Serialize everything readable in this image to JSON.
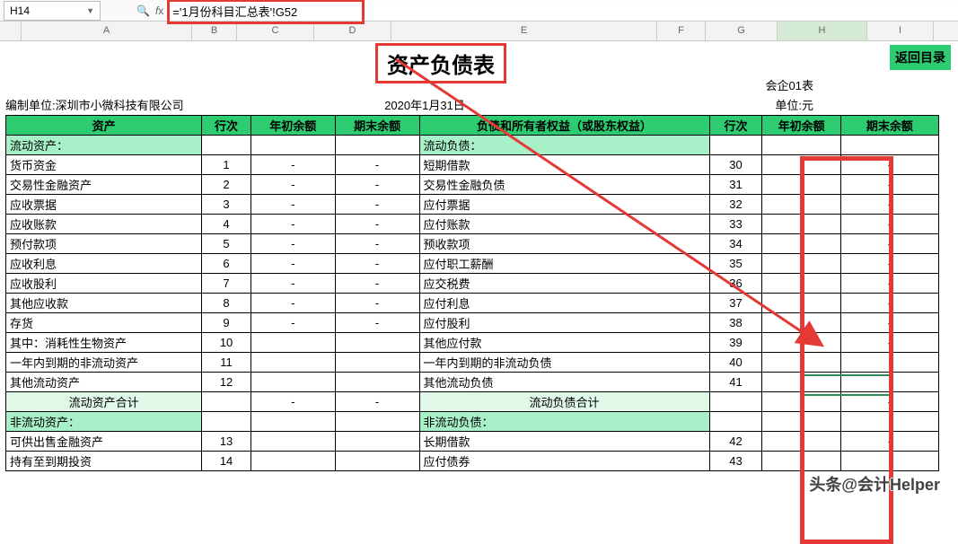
{
  "nameBox": "H14",
  "formula": "='1月份科目汇总表'!G52",
  "columns": [
    "A",
    "B",
    "C",
    "D",
    "E",
    "F",
    "G",
    "H",
    "I"
  ],
  "title": "资产负债表",
  "returnBtn": "返回目录",
  "formCode": "会企01表",
  "unitLabel": "单位:元",
  "org": "编制单位:深圳市小微科技有限公司",
  "date": "2020年1月31日",
  "headers": {
    "a": "资产",
    "b": "行次",
    "c": "年初余额",
    "d": "期末余额",
    "e": "负债和所有者权益（或股东权益）",
    "f": "行次",
    "g": "年初余额",
    "h": "期末余额"
  },
  "rows": [
    {
      "type": "sec",
      "a": "流动资产：",
      "e": "流动负债："
    },
    {
      "a": "货币资金",
      "b": "1",
      "c": "-",
      "d": "-",
      "e": "短期借款",
      "f": "30",
      "g": "",
      "h": "-"
    },
    {
      "a": "交易性金融资产",
      "b": "2",
      "c": "-",
      "d": "-",
      "e": "交易性金融负债",
      "f": "31",
      "g": "",
      "h": "-"
    },
    {
      "a": "应收票据",
      "b": "3",
      "c": "-",
      "d": "-",
      "e": "应付票据",
      "f": "32",
      "g": "-",
      "h": "-"
    },
    {
      "a": "应收账款",
      "b": "4",
      "c": "-",
      "d": "-",
      "e": "应付账款",
      "f": "33",
      "g": "-",
      "h": "-"
    },
    {
      "a": "预付款项",
      "b": "5",
      "c": "-",
      "d": "-",
      "e": "预收款项",
      "f": "34",
      "g": "-",
      "h": "-"
    },
    {
      "a": "应收利息",
      "b": "6",
      "c": "-",
      "d": "-",
      "e": "应付职工薪酬",
      "f": "35",
      "g": "",
      "h": "-"
    },
    {
      "a": "应收股利",
      "b": "7",
      "c": "-",
      "d": "-",
      "e": "应交税费",
      "f": "36",
      "g": "",
      "h": "-"
    },
    {
      "a": "其他应收款",
      "b": "8",
      "c": "-",
      "d": "-",
      "e": "应付利息",
      "f": "37",
      "g": "",
      "h": "-"
    },
    {
      "a": "存货",
      "b": "9",
      "c": "-",
      "d": "-",
      "e": "应付股利",
      "f": "38",
      "g": "",
      "h": "-"
    },
    {
      "a": "其中：消耗性生物资产",
      "b": "10",
      "c": "",
      "d": "",
      "e": "其他应付款",
      "f": "39",
      "g": "-",
      "h": "-"
    },
    {
      "a": "一年内到期的非流动资产",
      "b": "11",
      "c": "",
      "d": "",
      "e": "一年内到期的非流动负债",
      "f": "40",
      "g": "",
      "h": ""
    },
    {
      "a": "其他流动资产",
      "b": "12",
      "c": "",
      "d": "",
      "e": "其他流动负债",
      "f": "41",
      "g": "",
      "h": ""
    },
    {
      "type": "sub",
      "a": "流动资产合计",
      "c": "-",
      "d": "-",
      "e": "流动负债合计",
      "g": "-",
      "h": "-"
    },
    {
      "type": "sec",
      "a": "非流动资产：",
      "e": "非流动负债："
    },
    {
      "a": "可供出售金融资产",
      "b": "13",
      "c": "",
      "d": "",
      "e": "长期借款",
      "f": "42",
      "g": "-",
      "h": "-"
    },
    {
      "a": "持有至到期投资",
      "b": "14",
      "c": "",
      "d": "",
      "e": "应付债券",
      "f": "43",
      "g": "",
      "h": ""
    }
  ],
  "watermark": "头条@会计Helper",
  "chart_data": {
    "type": "table",
    "title": "资产负债表 (Balance Sheet)",
    "date": "2020年1月31日",
    "org": "深圳市小微科技有限公司",
    "unit": "元",
    "columns_left": [
      "资产",
      "行次",
      "年初余额",
      "期末余额"
    ],
    "columns_right": [
      "负债和所有者权益（或股东权益）",
      "行次",
      "年初余额",
      "期末余额"
    ],
    "records": [
      {
        "asset": "流动资产：",
        "liab": "流动负债："
      },
      {
        "asset": "货币资金",
        "a_row": 1,
        "liab": "短期借款",
        "l_row": 30
      },
      {
        "asset": "交易性金融资产",
        "a_row": 2,
        "liab": "交易性金融负债",
        "l_row": 31
      },
      {
        "asset": "应收票据",
        "a_row": 3,
        "liab": "应付票据",
        "l_row": 32
      },
      {
        "asset": "应收账款",
        "a_row": 4,
        "liab": "应付账款",
        "l_row": 33
      },
      {
        "asset": "预付款项",
        "a_row": 5,
        "liab": "预收款项",
        "l_row": 34
      },
      {
        "asset": "应收利息",
        "a_row": 6,
        "liab": "应付职工薪酬",
        "l_row": 35
      },
      {
        "asset": "应收股利",
        "a_row": 7,
        "liab": "应交税费",
        "l_row": 36
      },
      {
        "asset": "其他应收款",
        "a_row": 8,
        "liab": "应付利息",
        "l_row": 37
      },
      {
        "asset": "存货",
        "a_row": 9,
        "liab": "应付股利",
        "l_row": 38
      },
      {
        "asset": "其中：消耗性生物资产",
        "a_row": 10,
        "liab": "其他应付款",
        "l_row": 39
      },
      {
        "asset": "一年内到期的非流动资产",
        "a_row": 11,
        "liab": "一年内到期的非流动负债",
        "l_row": 40
      },
      {
        "asset": "其他流动资产",
        "a_row": 12,
        "liab": "其他流动负债",
        "l_row": 41
      },
      {
        "asset": "流动资产合计",
        "liab": "流动负债合计"
      },
      {
        "asset": "非流动资产：",
        "liab": "非流动负债："
      },
      {
        "asset": "可供出售金融资产",
        "a_row": 13,
        "liab": "长期借款",
        "l_row": 42
      },
      {
        "asset": "持有至到期投资",
        "a_row": 14,
        "liab": "应付债券",
        "l_row": 43
      }
    ]
  }
}
